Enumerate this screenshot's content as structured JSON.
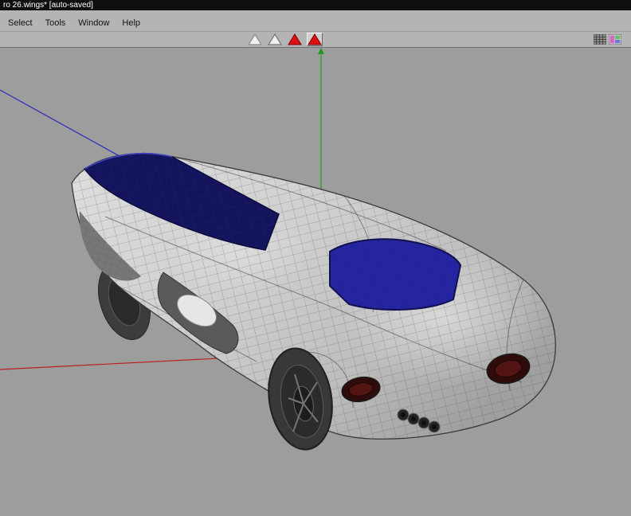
{
  "window": {
    "title": "ro 26.wings* [auto-saved]"
  },
  "menu": {
    "items": [
      {
        "label": "Select"
      },
      {
        "label": "Tools"
      },
      {
        "label": "Window"
      },
      {
        "label": "Help"
      }
    ]
  },
  "toolbar": {
    "mode_icons": [
      {
        "name": "vertex-select-mode-icon",
        "active": false
      },
      {
        "name": "edge-select-mode-icon",
        "active": false
      },
      {
        "name": "face-select-mode-icon",
        "active": true
      },
      {
        "name": "body-select-mode-icon",
        "active": true,
        "pressed": true
      }
    ],
    "view_icons": [
      {
        "name": "wireframe-view-icon"
      },
      {
        "name": "smooth-view-icon"
      }
    ]
  },
  "colors": {
    "titlebar_bg": "#0f0f0f",
    "titlebar_text": "#ffffff",
    "menubar_bg": "#b4b4b4",
    "viewport_bg": "#9d9d9d",
    "axis_red": "#bb2222",
    "axis_green": "#1e9e1e",
    "axis_blue": "#2a2ac0",
    "triangle_white": "#f0f0f0",
    "triangle_red": "#e01010",
    "glass_blue_dark": "#14145e",
    "glass_blue": "#2424a0",
    "taillight_red": "#2e0c0c"
  }
}
